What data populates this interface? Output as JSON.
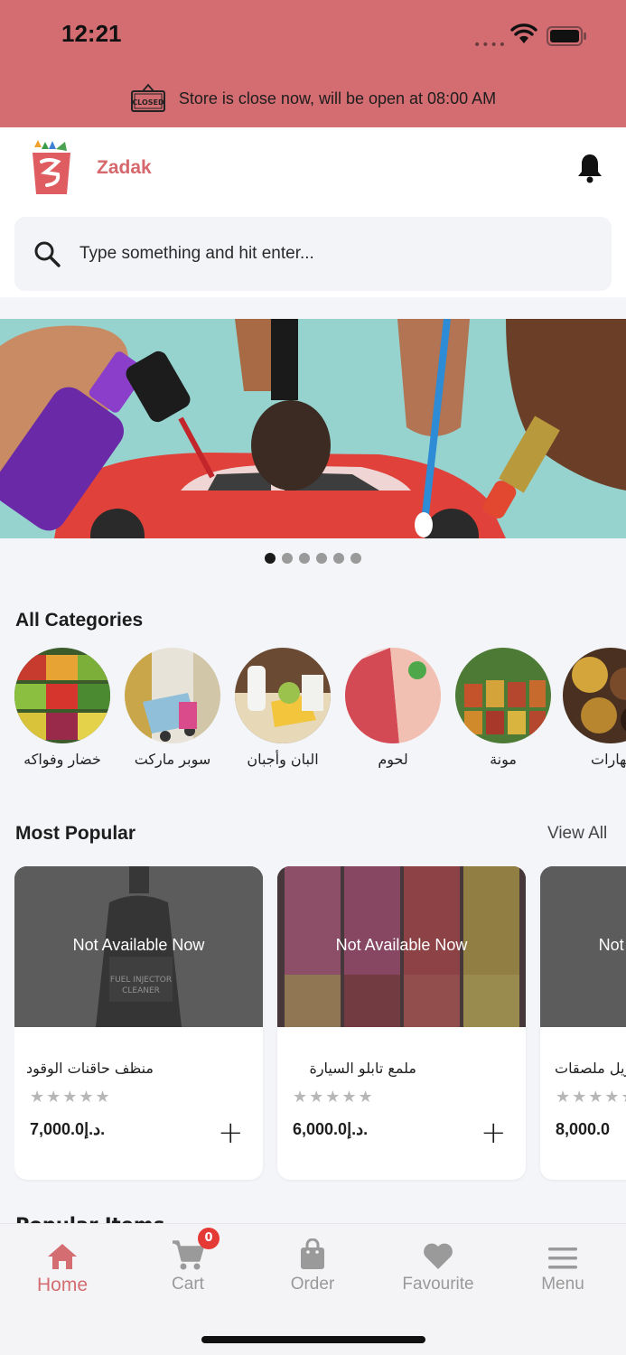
{
  "status_bar": {
    "time": "12:21",
    "signal": "••••"
  },
  "store_notice": {
    "icon": "closed-sign-icon",
    "text": "Store is close now, will be open at 08:00 AM",
    "bg_color": "#d36d72"
  },
  "header": {
    "brand": "Zadak",
    "brand_color": "#d6676c",
    "logo": "zadak-logo",
    "bell_icon": "bell-icon"
  },
  "search": {
    "placeholder": "Type something and hit enter..."
  },
  "banner": {
    "slides": 6,
    "active": 0
  },
  "categories": {
    "title": "All Categories",
    "items": [
      {
        "label": "خضار وفواكه"
      },
      {
        "label": "سوبر ماركت"
      },
      {
        "label": "البان وأجبان"
      },
      {
        "label": "لحوم"
      },
      {
        "label": "مونة"
      },
      {
        "label": "بهارات"
      }
    ]
  },
  "popular": {
    "title": "Most Popular",
    "view_all": "View All",
    "items": [
      {
        "status": "Not Available Now",
        "name": "منظف حاقنات الوقود",
        "rating": "★★★★★",
        "price": "7,000.0د.إ.",
        "add": "+"
      },
      {
        "status": "Not Available Now",
        "name": "ملمع تابلو السيارة",
        "rating": "★★★★★",
        "price": "6,000.0د.إ.",
        "add": "+"
      },
      {
        "status": "Not Available Now",
        "name": "مزيل ملصقات",
        "rating": "★★★★★",
        "price": "8,000.0",
        "add": "+"
      }
    ]
  },
  "next_section": {
    "title": "Popular Items"
  },
  "tabbar": {
    "items": [
      {
        "label": "Home",
        "icon": "home-icon",
        "active": true
      },
      {
        "label": "Cart",
        "icon": "cart-icon",
        "badge": "0"
      },
      {
        "label": "Order",
        "icon": "shopping-bag-icon"
      },
      {
        "label": "Favourite",
        "icon": "heart-icon"
      },
      {
        "label": "Menu",
        "icon": "menu-icon"
      }
    ],
    "active_color": "#d36d72"
  }
}
